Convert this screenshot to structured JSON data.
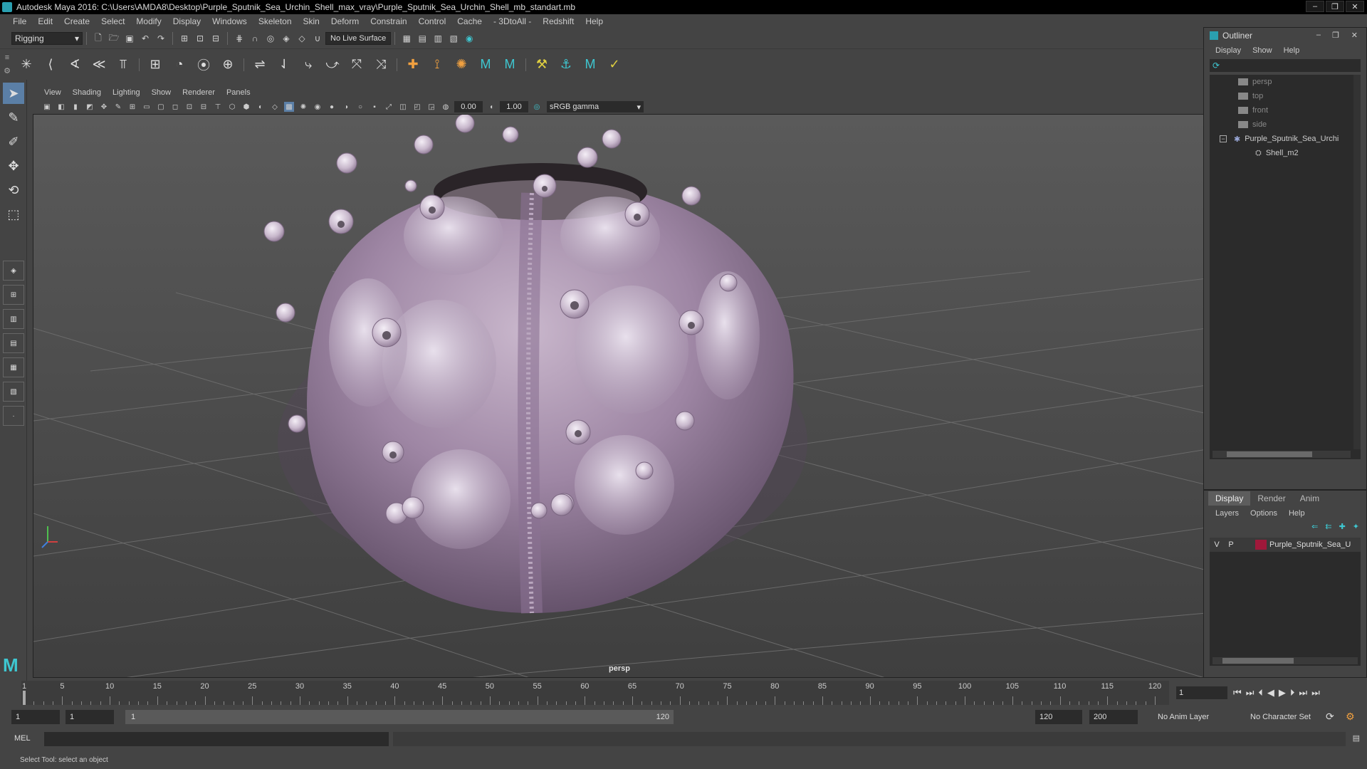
{
  "window": {
    "title": "Autodesk Maya 2016: C:\\Users\\AMDA8\\Desktop\\Purple_Sputnik_Sea_Urchin_Shell_max_vray\\Purple_Sputnik_Sea_Urchin_Shell_mb_standart.mb",
    "minimize": "‒",
    "restore": "❐",
    "close": "✕"
  },
  "menubar": [
    "File",
    "Edit",
    "Create",
    "Select",
    "Modify",
    "Display",
    "Windows",
    "Skeleton",
    "Skin",
    "Deform",
    "Constrain",
    "Control",
    "Cache",
    "- 3DtoAll -",
    "Redshift",
    "Help"
  ],
  "statusline": {
    "mode": "Rigging",
    "live_surface": "No Live Surface"
  },
  "viewport": {
    "menu": [
      "View",
      "Shading",
      "Lighting",
      "Show",
      "Renderer",
      "Panels"
    ],
    "exposure": "0.00",
    "gamma_value": "1.00",
    "color_space": "sRGB gamma",
    "camera_label": "persp"
  },
  "outliner": {
    "title": "Outliner",
    "menu": [
      "Display",
      "Show",
      "Help"
    ],
    "items": [
      {
        "label": "persp",
        "dim": true
      },
      {
        "label": "top",
        "dim": true
      },
      {
        "label": "front",
        "dim": true
      },
      {
        "label": "side",
        "dim": true
      },
      {
        "label": "Purple_Sputnik_Sea_Urchi",
        "dim": false
      },
      {
        "label": "Shell_m2",
        "dim": false
      }
    ]
  },
  "layers": {
    "tabs": [
      "Display",
      "Render",
      "Anim"
    ],
    "active_tab": "Display",
    "menu": [
      "Layers",
      "Options",
      "Help"
    ],
    "rows": [
      {
        "v": "V",
        "p": "P",
        "name": "Purple_Sputnik_Sea_U",
        "color": "#a0183a"
      }
    ]
  },
  "timeline": {
    "ticks": [
      1,
      5,
      10,
      15,
      20,
      25,
      30,
      35,
      40,
      45,
      50,
      55,
      60,
      65,
      70,
      75,
      80,
      85,
      90,
      95,
      100,
      105,
      110,
      115,
      120
    ],
    "current_frame": "1"
  },
  "range": {
    "start": "1",
    "playback_start": "1",
    "slider_start": "1",
    "slider_end": "120",
    "playback_end": "120",
    "end": "200",
    "anim_layer": "No Anim Layer",
    "character_set": "No Character Set"
  },
  "commandline": {
    "label": "MEL"
  },
  "helpline": {
    "text": "Select Tool: select an object"
  }
}
